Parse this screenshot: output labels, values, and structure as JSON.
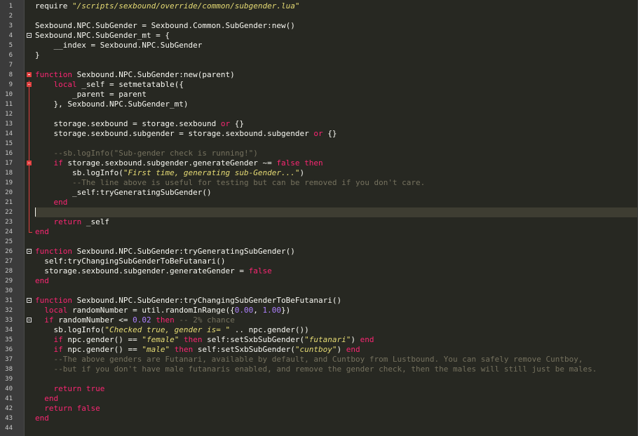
{
  "colors": {
    "background": "#272822",
    "gutter": "#3b3b3b",
    "text": "#f8f8f2",
    "string": "#e6db74",
    "keyword": "#f92672",
    "number": "#ae81ff",
    "comment": "#75715e",
    "fold_marker_active": "#e04040",
    "current_line": "#3e3d32"
  },
  "editor": {
    "current_line": 22,
    "lines": [
      {
        "n": "1",
        "t": [
          [
            "p",
            "require "
          ],
          [
            "s",
            "\"/scripts/sexbound/override/common/subgender.lua\""
          ]
        ]
      },
      {
        "n": "2",
        "t": []
      },
      {
        "n": "3",
        "t": [
          [
            "p",
            "Sexbound.NPC.SubGender = Sexbound.Common.SubGender:new()"
          ]
        ]
      },
      {
        "n": "4",
        "t": [
          [
            "p",
            "Sexbound.NPC.SubGender_mt = {"
          ]
        ]
      },
      {
        "n": "5",
        "t": [
          [
            "p",
            "    __index = Sexbound.NPC.SubGender"
          ]
        ]
      },
      {
        "n": "6",
        "t": [
          [
            "p",
            "}"
          ]
        ]
      },
      {
        "n": "7",
        "t": []
      },
      {
        "n": "8",
        "t": [
          [
            "k",
            "function"
          ],
          [
            "p",
            " Sexbound.NPC.SubGender:new(parent)"
          ]
        ]
      },
      {
        "n": "9",
        "t": [
          [
            "p",
            "    "
          ],
          [
            "k",
            "local"
          ],
          [
            "p",
            " _self = setmetatable({"
          ]
        ]
      },
      {
        "n": "10",
        "t": [
          [
            "p",
            "        _parent = parent"
          ]
        ]
      },
      {
        "n": "11",
        "t": [
          [
            "p",
            "    }, Sexbound.NPC.SubGender_mt)"
          ]
        ]
      },
      {
        "n": "12",
        "t": []
      },
      {
        "n": "13",
        "t": [
          [
            "p",
            "    storage.sexbound = storage.sexbound "
          ],
          [
            "k",
            "or"
          ],
          [
            "p",
            " {}"
          ]
        ]
      },
      {
        "n": "14",
        "t": [
          [
            "p",
            "    storage.sexbound.subgender = storage.sexbound.subgender "
          ],
          [
            "k",
            "or"
          ],
          [
            "p",
            " {}"
          ]
        ]
      },
      {
        "n": "15",
        "t": []
      },
      {
        "n": "16",
        "t": [
          [
            "c",
            "    --sb.logInfo(\"Sub-gender check is running!\")"
          ]
        ]
      },
      {
        "n": "17",
        "t": [
          [
            "p",
            "    "
          ],
          [
            "k",
            "if"
          ],
          [
            "p",
            " storage.sexbound.subgender.generateGender ~= "
          ],
          [
            "k",
            "false"
          ],
          [
            "p",
            " "
          ],
          [
            "k",
            "then"
          ]
        ]
      },
      {
        "n": "18",
        "t": [
          [
            "p",
            "        sb.logInfo("
          ],
          [
            "s",
            "\"First time, generating sub-Gender...\""
          ],
          [
            "p",
            ")"
          ]
        ]
      },
      {
        "n": "19",
        "t": [
          [
            "c",
            "        --The line above is useful for testing but can be removed if you don't care."
          ]
        ]
      },
      {
        "n": "20",
        "t": [
          [
            "p",
            "        _self:tryGeneratingSubGender()"
          ]
        ]
      },
      {
        "n": "21",
        "t": [
          [
            "p",
            "    "
          ],
          [
            "k",
            "end"
          ]
        ]
      },
      {
        "n": "22",
        "t": []
      },
      {
        "n": "23",
        "t": [
          [
            "p",
            "    "
          ],
          [
            "k",
            "return"
          ],
          [
            "p",
            " _self"
          ]
        ]
      },
      {
        "n": "24",
        "t": [
          [
            "k",
            "end"
          ]
        ]
      },
      {
        "n": "25",
        "t": []
      },
      {
        "n": "26",
        "t": [
          [
            "k",
            "function"
          ],
          [
            "p",
            " Sexbound.NPC.SubGender:tryGeneratingSubGender()"
          ]
        ]
      },
      {
        "n": "27",
        "t": [
          [
            "p",
            "  self:tryChangingSubGenderToBeFutanari()"
          ]
        ]
      },
      {
        "n": "28",
        "t": [
          [
            "p",
            "  storage.sexbound.subgender.generateGender = "
          ],
          [
            "k",
            "false"
          ]
        ]
      },
      {
        "n": "29",
        "t": [
          [
            "k",
            "end"
          ]
        ]
      },
      {
        "n": "30",
        "t": []
      },
      {
        "n": "31",
        "t": [
          [
            "k",
            "function"
          ],
          [
            "p",
            " Sexbound.NPC.SubGender:tryChangingSubGenderToBeFutanari()"
          ]
        ]
      },
      {
        "n": "32",
        "t": [
          [
            "p",
            "  "
          ],
          [
            "k",
            "local"
          ],
          [
            "p",
            " randomNumber = util.randomInRange({"
          ],
          [
            "n",
            "0.00"
          ],
          [
            "p",
            ", "
          ],
          [
            "n",
            "1.00"
          ],
          [
            "p",
            "})"
          ]
        ]
      },
      {
        "n": "33",
        "t": [
          [
            "p",
            "  "
          ],
          [
            "k",
            "if"
          ],
          [
            "p",
            " randomNumber <= "
          ],
          [
            "n",
            "0.02"
          ],
          [
            "p",
            " "
          ],
          [
            "k",
            "then"
          ],
          [
            "p",
            " "
          ],
          [
            "c",
            "-- 2% chance"
          ]
        ]
      },
      {
        "n": "34",
        "t": [
          [
            "p",
            "    sb.logInfo("
          ],
          [
            "s",
            "\"Checked true, gender is= \""
          ],
          [
            "p",
            " .. npc.gender())"
          ]
        ]
      },
      {
        "n": "35",
        "t": [
          [
            "p",
            "    "
          ],
          [
            "k",
            "if"
          ],
          [
            "p",
            " npc.gender() == "
          ],
          [
            "s",
            "\"female\""
          ],
          [
            "p",
            " "
          ],
          [
            "k",
            "then"
          ],
          [
            "p",
            " self:setSxbSubGender("
          ],
          [
            "s",
            "\"futanari\""
          ],
          [
            "p",
            ") "
          ],
          [
            "k",
            "end"
          ]
        ]
      },
      {
        "n": "36",
        "t": [
          [
            "p",
            "    "
          ],
          [
            "k",
            "if"
          ],
          [
            "p",
            " npc.gender() == "
          ],
          [
            "s",
            "\"male\""
          ],
          [
            "p",
            " "
          ],
          [
            "k",
            "then"
          ],
          [
            "p",
            " self:setSxbSubGender("
          ],
          [
            "s",
            "\"cuntboy\""
          ],
          [
            "p",
            ") "
          ],
          [
            "k",
            "end"
          ]
        ]
      },
      {
        "n": "37",
        "t": [
          [
            "c",
            "    --The above genders are Futanari, available by default, and Cuntboy from Lustbound. You can safely remove Cuntboy,"
          ]
        ]
      },
      {
        "n": "38",
        "t": [
          [
            "c",
            "    --but if you don't have male futanaris enabled, and remove the gender check, then the males will still just be males."
          ]
        ]
      },
      {
        "n": "39",
        "t": []
      },
      {
        "n": "40",
        "t": [
          [
            "p",
            "    "
          ],
          [
            "k",
            "return"
          ],
          [
            "p",
            " "
          ],
          [
            "k",
            "true"
          ]
        ]
      },
      {
        "n": "41",
        "t": [
          [
            "p",
            "  "
          ],
          [
            "k",
            "end"
          ]
        ]
      },
      {
        "n": "42",
        "t": [
          [
            "p",
            "  "
          ],
          [
            "k",
            "return"
          ],
          [
            "p",
            " "
          ],
          [
            "k",
            "false"
          ]
        ]
      },
      {
        "n": "43",
        "t": [
          [
            "k",
            "end"
          ]
        ]
      },
      {
        "n": "44",
        "t": []
      }
    ]
  }
}
